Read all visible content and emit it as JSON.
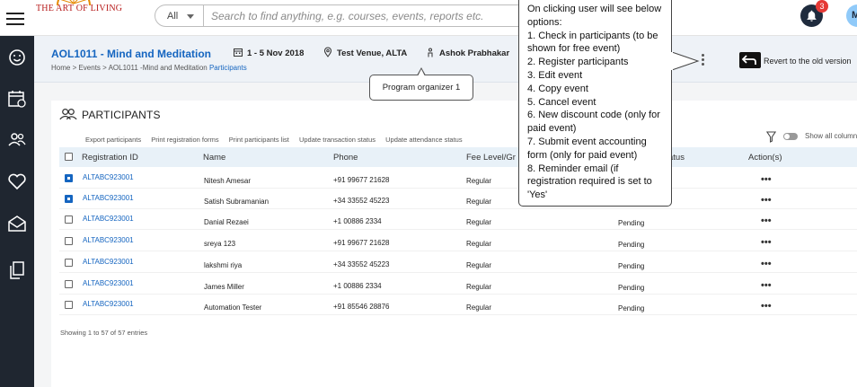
{
  "brand": {
    "logo_text": "THE ART OF LIVING"
  },
  "search": {
    "scope": "All",
    "placeholder": "Search to find anything, e.g. courses, events, reports etc."
  },
  "notifications": {
    "count": "3"
  },
  "user": {
    "initial": "M"
  },
  "event": {
    "title": "AOL1011 - Mind and Meditation",
    "dates": "1 - 5 Nov 2018",
    "venue": "Test Venue, ALTA",
    "organizer": "Ashok Prabhakar"
  },
  "breadcrumb": {
    "path": "Home > Events > AOL1011 -Mind and Meditation",
    "current": "Participants"
  },
  "revert": {
    "label": "Revert to the old version"
  },
  "organizer_tooltip": "Program organizer 1",
  "participants": {
    "heading": "PARTICIPANTS",
    "actions": [
      "Export participants",
      "Print registration forms",
      "Print participants list",
      "Update transaction status",
      "Update attendance status"
    ],
    "show_all_columns": "Show all columns",
    "columns": {
      "registration_id": "Registration ID",
      "name": "Name",
      "phone": "Phone",
      "fee_level": "Fee Level/Gr",
      "status": "atus",
      "actions": "Action(s)"
    },
    "rows": [
      {
        "id": "ALTABC923001",
        "name": "Nitesh Amesar",
        "phone": "+91 99677 21628",
        "fee": "Regular",
        "status": "",
        "checked": true
      },
      {
        "id": "ALTABC923001",
        "name": "Satish Subramanian",
        "phone": "+34 33552 45223",
        "fee": "Regular",
        "status": "",
        "checked": true
      },
      {
        "id": "ALTABC923001",
        "name": "Danial Rezaei",
        "phone": "+1 00886 2334",
        "fee": "Regular",
        "status": "Pending",
        "checked": false
      },
      {
        "id": "ALTABC923001",
        "name": "sreya 123",
        "phone": "+91 99677 21628",
        "fee": "Regular",
        "status": "Pending",
        "checked": false
      },
      {
        "id": "ALTABC923001",
        "name": "lakshmi riya",
        "phone": "+34 33552 45223",
        "fee": "Regular",
        "status": "Pending",
        "checked": false
      },
      {
        "id": "ALTABC923001",
        "name": "James Miller",
        "phone": "+1 00886 2334",
        "fee": "Regular",
        "status": "Pending",
        "checked": false
      },
      {
        "id": "ALTABC923001",
        "name": "Automation Tester",
        "phone": "+91 85546 28876",
        "fee": "Regular",
        "status": "Pending",
        "checked": false
      }
    ],
    "row_action": "•••",
    "footer": "Showing 1 to 57 of 57 entries"
  },
  "note": {
    "intro": "On clicking user will see below options:",
    "items": [
      "1. Check in participants (to be shown for free event)",
      "2. Register participants",
      "3. Edit event",
      "4. Copy event",
      "5. Cancel event",
      "6. New discount code (only for paid event)",
      "7. Submit event accounting form (only for paid event)",
      "8. Reminder email (if registration required is set to 'Yes'"
    ]
  },
  "colors": {
    "accent": "#1565c0",
    "sidebar": "#1f2630",
    "header_bg": "#eef2f7",
    "badge": "#e53935"
  }
}
